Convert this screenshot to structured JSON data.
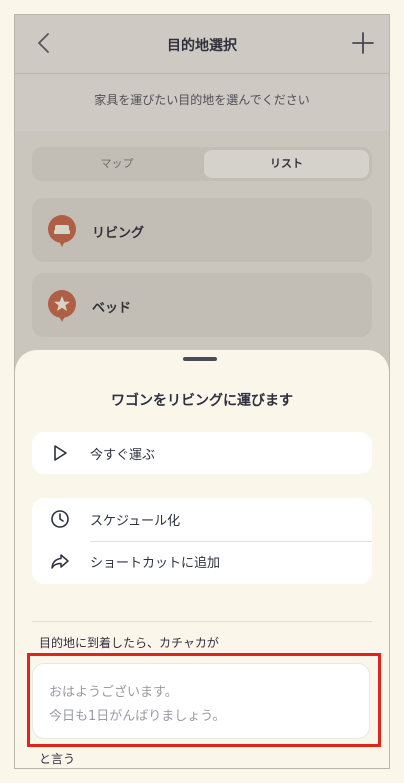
{
  "nav": {
    "title": "目的地選択"
  },
  "subtitle": "家具を運びたい目的地を選んでください",
  "segment": {
    "map": "マップ",
    "list": "リスト"
  },
  "destinations": [
    {
      "label": "リビング",
      "icon": "sofa-icon"
    },
    {
      "label": "ベッド",
      "icon": "star-icon"
    }
  ],
  "sheet": {
    "title": "ワゴンをリビングに運びます",
    "run_now": "今すぐ運ぶ",
    "schedule": "スケジュール化",
    "shortcut": "ショートカットに追加",
    "arrival_prompt": "目的地に到着したら、カチャカが",
    "speech_line1": "おはようございます。",
    "speech_line2": "今日も1日がんばりましょう。",
    "suffix": "と言う"
  },
  "colors": {
    "accent": "#c8684a",
    "highlight": "#e0241b",
    "text": "#2f3040"
  }
}
